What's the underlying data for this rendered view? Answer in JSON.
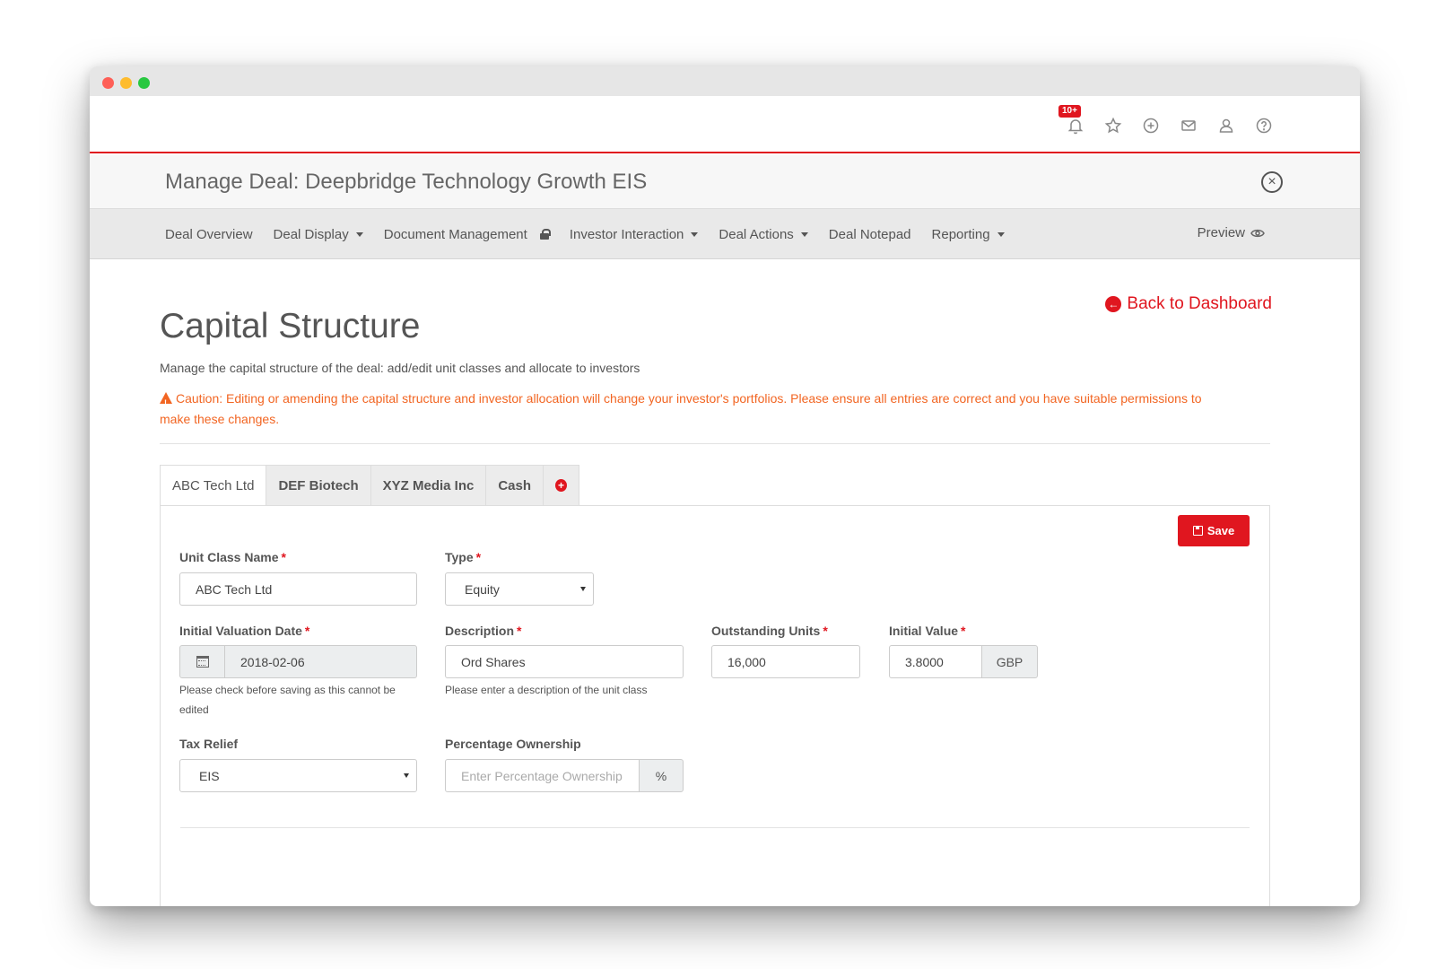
{
  "topbar": {
    "notification_badge": "10+",
    "icons": [
      "bell-icon",
      "star-icon",
      "plus-circle-icon",
      "mail-icon",
      "user-icon",
      "help-icon"
    ]
  },
  "deal": {
    "title": "Manage Deal: Deepbridge Technology Growth EIS"
  },
  "nav": {
    "items": [
      {
        "label": "Deal Overview"
      },
      {
        "label": "Deal Display"
      },
      {
        "label": "Document Management"
      },
      {
        "label": "Investor Interaction"
      },
      {
        "label": "Deal Actions"
      },
      {
        "label": "Deal Notepad"
      },
      {
        "label": "Reporting"
      }
    ],
    "preview": "Preview"
  },
  "page": {
    "back_link": "Back to Dashboard",
    "title": "Capital Structure",
    "subtitle": "Manage the capital structure of the deal: add/edit unit classes and allocate to investors",
    "caution": "Caution: Editing or amending the capital structure and investor allocation will change your investor's portfolios. Please ensure all entries are correct and you have suitable permissions to make these changes."
  },
  "tabs": [
    {
      "label": "ABC Tech Ltd",
      "active": true
    },
    {
      "label": "DEF Biotech"
    },
    {
      "label": "XYZ Media Inc"
    },
    {
      "label": "Cash"
    }
  ],
  "form": {
    "save_label": "Save",
    "unit_class_name": {
      "label": "Unit Class Name",
      "value": "ABC Tech Ltd"
    },
    "type": {
      "label": "Type",
      "value": "Equity"
    },
    "initial_valuation_date": {
      "label": "Initial Valuation Date",
      "value": "2018-02-06",
      "help": "Please check before saving as this cannot be edited"
    },
    "description": {
      "label": "Description",
      "value": "Ord Shares",
      "help": "Please enter a description of the unit class"
    },
    "outstanding_units": {
      "label": "Outstanding Units",
      "value": "16,000"
    },
    "initial_value": {
      "label": "Initial Value",
      "value": "3.8000",
      "currency": "GBP"
    },
    "tax_relief": {
      "label": "Tax Relief",
      "value": "EIS"
    },
    "percentage_ownership": {
      "label": "Percentage Ownership",
      "placeholder": "Enter Percentage Ownership",
      "unit": "%"
    },
    "required_mark": "*"
  },
  "colors": {
    "brand_red": "#e0161f",
    "caution_orange": "#f26522"
  }
}
